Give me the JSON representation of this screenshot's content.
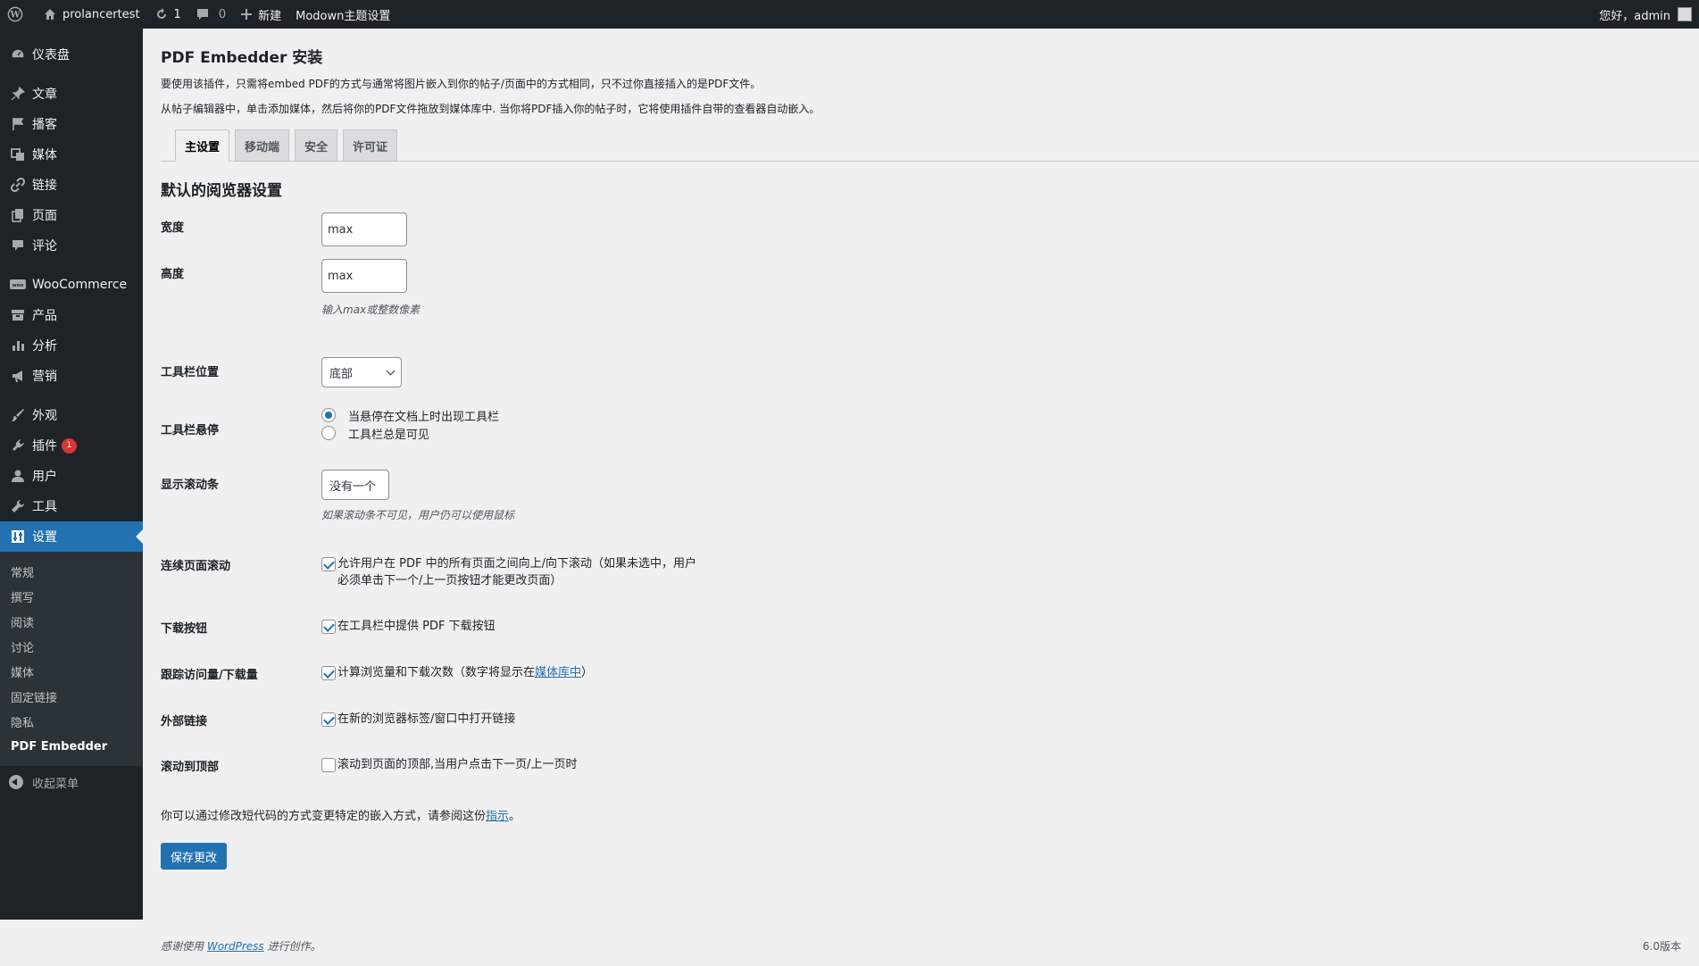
{
  "adminbar": {
    "site_name": "prolancertest",
    "updates_count": "1",
    "comments_count": "0",
    "new_label": "新建",
    "theme_settings": "Modown主题设置",
    "greeting": "您好，admin"
  },
  "sidebar": {
    "items": [
      {
        "label": "仪表盘",
        "icon": "dashboard-icon"
      },
      {
        "label": "文章",
        "icon": "pin-icon"
      },
      {
        "label": "播客",
        "icon": "flag-icon"
      },
      {
        "label": "媒体",
        "icon": "media-icon"
      },
      {
        "label": "链接",
        "icon": "link-icon"
      },
      {
        "label": "页面",
        "icon": "page-icon"
      },
      {
        "label": "评论",
        "icon": "comment-icon"
      },
      {
        "label": "WooCommerce",
        "icon": "woo-icon"
      },
      {
        "label": "产品",
        "icon": "archive-icon"
      },
      {
        "label": "分析",
        "icon": "chart-icon"
      },
      {
        "label": "营销",
        "icon": "megaphone-icon"
      },
      {
        "label": "外观",
        "icon": "brush-icon"
      },
      {
        "label": "插件",
        "icon": "plugin-icon",
        "badge": "1"
      },
      {
        "label": "用户",
        "icon": "user-icon"
      },
      {
        "label": "工具",
        "icon": "wrench-icon"
      },
      {
        "label": "设置",
        "icon": "settings-icon"
      }
    ],
    "submenu": [
      "常规",
      "撰写",
      "阅读",
      "讨论",
      "媒体",
      "固定链接",
      "隐私",
      "PDF Embedder"
    ],
    "collapse_label": "收起菜单"
  },
  "page": {
    "title": "PDF Embedder 安装",
    "intro1": "要使用该插件，只需将embed PDF的方式与通常将图片嵌入到你的帖子/页面中的方式相同，只不过你直接插入的是PDF文件。",
    "intro2": "从帖子编辑器中，单击添加媒体，然后将你的PDF文件拖放到媒体库中. 当你将PDF插入你的帖子时，它将使用插件自带的查看器自动嵌入。",
    "tabs": [
      "主设置",
      "移动端",
      "安全",
      "许可证"
    ],
    "section_title": "默认的阅览器设置"
  },
  "form": {
    "width_label": "宽度",
    "width_value": "max",
    "height_label": "高度",
    "height_value": "max",
    "size_hint": "输入max或整数像素",
    "toolbar_pos_label": "工具栏位置",
    "toolbar_pos_value": "底部",
    "toolbar_hover_label": "工具栏悬停",
    "toolbar_hover_opt1": "当悬停在文档上时出现工具栏",
    "toolbar_hover_opt2": "工具栏总是可见",
    "scrollbar_label": "显示滚动条",
    "scrollbar_value": "没有一个",
    "scrollbar_hint": "如果滚动条不可见，用户仍可以使用鼠标",
    "continuous_label": "连续页面滚动",
    "continuous_text1": "允许用户在 PDF 中的所有页面之间向上/向下滚动（如果未选中，用户",
    "continuous_text2": "必须单击下一个/上一页按钮才能更改页面）",
    "download_label": "下载按钮",
    "download_text": "在工具栏中提供 PDF 下载按钮",
    "tracking_label": "跟踪访问量/下载量",
    "tracking_text": "计算浏览量和下载次数（数字将显示在",
    "tracking_link": "媒体库中",
    "tracking_close": "）",
    "external_label": "外部链接",
    "external_text": "在新的浏览器标签/窗口中打开链接",
    "scrolltop_label": "滚动到顶部",
    "scrolltop_text": "滚动到页面的顶部,当用户点击下一页/上一页时",
    "shortcode_text": "你可以通过修改短代码的方式变更特定的嵌入方式，请参阅这份",
    "shortcode_link": "指示",
    "shortcode_end": "。",
    "save_label": "保存更改"
  },
  "footer": {
    "thanks_prefix": "感谢使用",
    "thanks_link": "WordPress",
    "thanks_suffix": "进行创作。",
    "version": "6.0版本"
  },
  "colors": {
    "accent": "#2271b1",
    "sidebar_bg": "#1d2327",
    "badge": "#d63638"
  }
}
